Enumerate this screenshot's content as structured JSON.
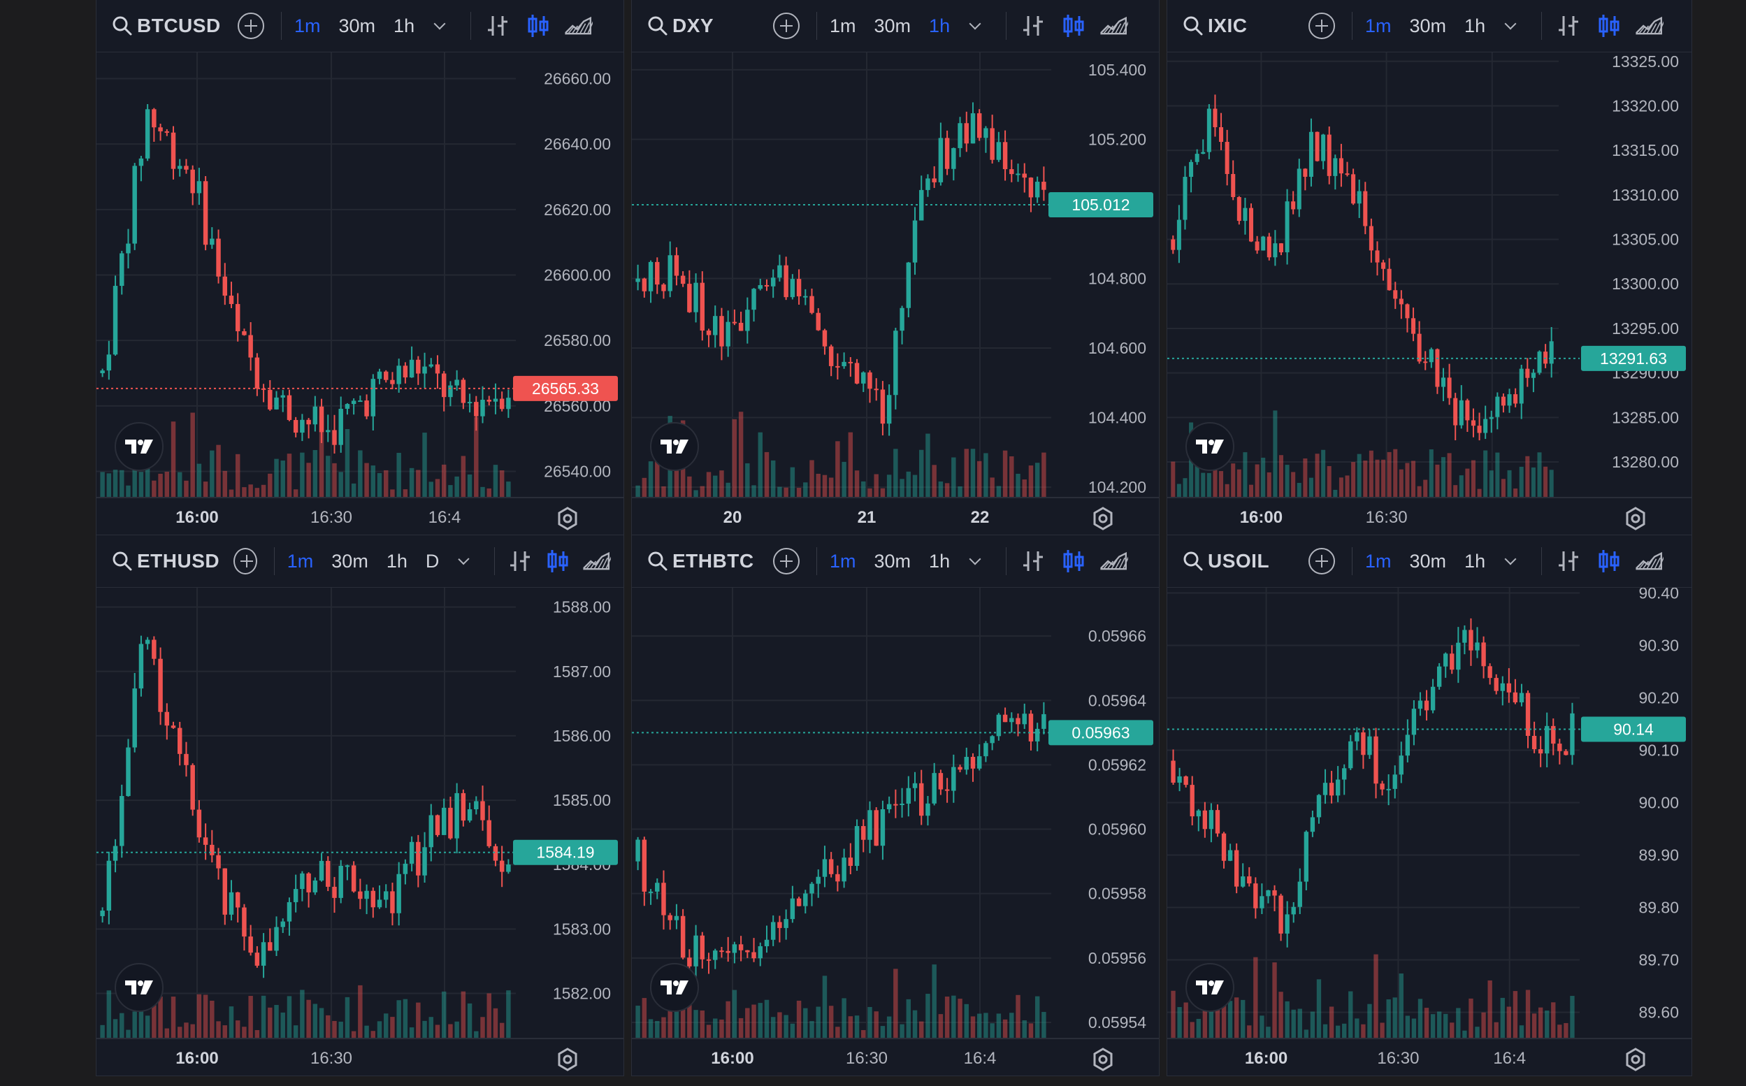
{
  "colors": {
    "up": "#26a69a",
    "down": "#ef5350",
    "grid": "#242832",
    "accent": "#2962ff",
    "bg": "#161a25"
  },
  "timeframes": [
    "1m",
    "30m",
    "1h"
  ],
  "panels": [
    {
      "symbol": "BTCUSD",
      "active_tf": "1m",
      "extra_tf": "",
      "price_labels": [
        "26660.00",
        "26640.00",
        "26620.00",
        "26600.00",
        "26580.00",
        "26560.00",
        "26540.00"
      ],
      "price_range": [
        26532,
        26668
      ],
      "current_price": "26565.33",
      "current_value": 26565.33,
      "current_dir": "down",
      "time_labels": [
        "16:00",
        "16:30",
        "16:4"
      ],
      "time_bold": [
        true,
        false,
        false
      ],
      "seed": 7,
      "trend": [
        26570,
        26650,
        26630,
        26580,
        26560,
        26552,
        26565,
        26572,
        26560,
        26566
      ],
      "icons": [
        "search-icon",
        "add-icon",
        "chevron-down-icon",
        "bar-chart-icon",
        "candles-icon",
        "area-chart-icon",
        "tradingview-logo",
        "settings-icon"
      ]
    },
    {
      "symbol": "DXY",
      "active_tf": "1h",
      "extra_tf": "",
      "price_labels": [
        "105.400",
        "105.200",
        "104.800",
        "104.600",
        "104.400",
        "104.200"
      ],
      "price_range": [
        104.17,
        105.45
      ],
      "current_price": "105.012",
      "current_value": 105.012,
      "current_dir": "up",
      "time_labels": [
        "20",
        "21",
        "22"
      ],
      "time_bold": [
        true,
        true,
        true
      ],
      "seed": 13,
      "trend": [
        104.79,
        104.82,
        104.62,
        104.76,
        104.8,
        104.55,
        104.4,
        105.05,
        105.25,
        105.15,
        105.02
      ],
      "icons": [
        "search-icon",
        "add-icon",
        "chevron-down-icon",
        "bar-chart-icon",
        "candles-icon",
        "area-chart-icon",
        "tradingview-logo",
        "settings-icon"
      ]
    },
    {
      "symbol": "IXIC",
      "active_tf": "1m",
      "extra_tf": "",
      "price_labels": [
        "13325.00",
        "13320.00",
        "13315.00",
        "13310.00",
        "13305.00",
        "13300.00",
        "13295.00",
        "13290.00",
        "13285.00",
        "13280.00"
      ],
      "price_range": [
        13276,
        13326
      ],
      "current_price": "13291.63",
      "current_value": 13291.63,
      "current_dir": "up",
      "time_labels": [
        "16:00",
        "16:30"
      ],
      "time_bold": [
        true,
        false
      ],
      "seed": 21,
      "trend": [
        13305,
        13318,
        13308,
        13303,
        13316,
        13312,
        13304,
        13294,
        13287,
        13283,
        13288,
        13292
      ],
      "icons": [
        "search-icon",
        "add-icon",
        "chevron-down-icon",
        "bar-chart-icon",
        "candles-icon",
        "area-chart-icon",
        "tradingview-logo",
        "settings-icon"
      ]
    },
    {
      "symbol": "ETHUSD",
      "active_tf": "1m",
      "extra_tf": "D",
      "price_labels": [
        "1588.00",
        "1587.00",
        "1586.00",
        "1585.00",
        "1584.00",
        "1583.00",
        "1582.00"
      ],
      "price_range": [
        1581.3,
        1588.3
      ],
      "current_price": "1584.19",
      "current_value": 1584.19,
      "current_dir": "up",
      "time_labels": [
        "16:00",
        "16:30"
      ],
      "time_bold": [
        true,
        false
      ],
      "seed": 31,
      "trend": [
        1583.2,
        1587.4,
        1585.4,
        1583.4,
        1582.6,
        1583.6,
        1583.9,
        1583.4,
        1584.4,
        1584.9,
        1584.1
      ],
      "icons": [
        "search-icon",
        "add-icon",
        "chevron-down-icon",
        "bar-chart-icon",
        "candles-icon",
        "area-chart-icon",
        "tradingview-logo",
        "settings-icon"
      ]
    },
    {
      "symbol": "ETHBTC",
      "active_tf": "1m",
      "extra_tf": "",
      "price_labels": [
        "0.05966",
        "0.05964",
        "0.05962",
        "0.05960",
        "0.05958",
        "0.05956",
        "0.05954"
      ],
      "price_range": [
        0.059535,
        0.059675
      ],
      "current_price": "0.05963",
      "current_value": 0.05963,
      "current_dir": "up",
      "time_labels": [
        "16:00",
        "16:30",
        "16:4"
      ],
      "time_bold": [
        true,
        false,
        false
      ],
      "seed": 41,
      "trend": [
        0.05959,
        0.05956,
        0.05956,
        0.05958,
        0.0596,
        0.05961,
        0.05963,
        0.05963
      ],
      "icons": [
        "search-icon",
        "add-icon",
        "chevron-down-icon",
        "bar-chart-icon",
        "candles-icon",
        "area-chart-icon",
        "tradingview-logo",
        "settings-icon"
      ]
    },
    {
      "symbol": "USOIL",
      "active_tf": "1m",
      "extra_tf": "",
      "price_labels": [
        "90.40",
        "90.30",
        "90.20",
        "90.10",
        "90.00",
        "89.90",
        "89.80",
        "89.70",
        "89.60"
      ],
      "price_range": [
        89.55,
        90.41
      ],
      "current_price": "90.14",
      "current_value": 90.14,
      "current_dir": "up",
      "time_labels": [
        "16:00",
        "16:30",
        "16:4"
      ],
      "time_bold": [
        true,
        false,
        false
      ],
      "seed": 53,
      "trend": [
        90.08,
        89.95,
        89.82,
        89.78,
        89.98,
        90.12,
        90.05,
        90.22,
        90.3,
        90.25,
        90.12,
        90.13
      ],
      "icons": [
        "search-icon",
        "add-icon",
        "chevron-down-icon",
        "bar-chart-icon",
        "candles-icon",
        "area-chart-icon",
        "tradingview-logo",
        "settings-icon"
      ]
    }
  ]
}
